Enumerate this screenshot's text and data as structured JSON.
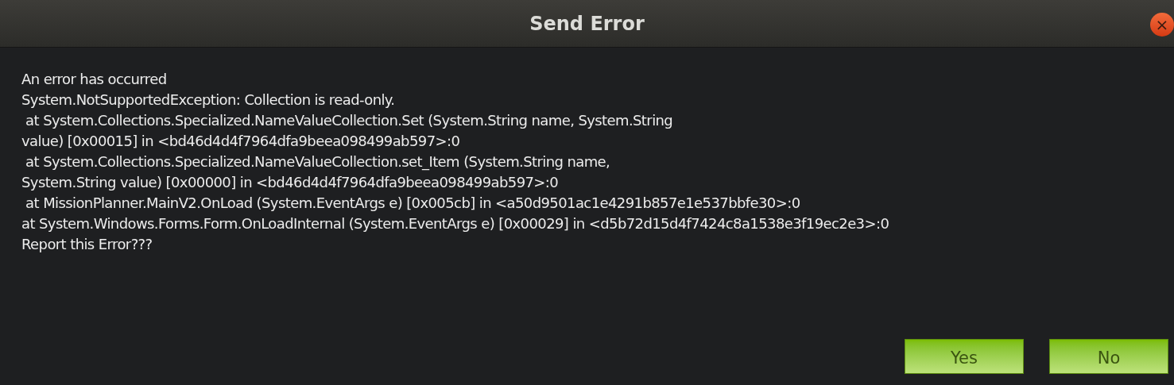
{
  "window": {
    "title": "Send Error",
    "close": "×"
  },
  "message_lines": [
    "An error has occurred",
    "System.NotSupportedException: Collection is read-only.",
    " at System.Collections.Specialized.NameValueCollection.Set (System.String name, System.String",
    "value) [0x00015] in <bd46d4d4f7964dfa9beea098499ab597>:0",
    " at System.Collections.Specialized.NameValueCollection.set_Item (System.String name,",
    "System.String value) [0x00000] in <bd46d4d4f7964dfa9beea098499ab597>:0",
    " at MissionPlanner.MainV2.OnLoad (System.EventArgs e) [0x005cb] in <a50d9501ac1e4291b857e1e537bbfe30>:0",
    "at System.Windows.Forms.Form.OnLoadInternal (System.EventArgs e) [0x00029] in <d5b72d15d4f7424c8a1538e3f19ec2e3>:0",
    "Report this Error???"
  ],
  "buttons": [
    "Yes",
    "No"
  ]
}
